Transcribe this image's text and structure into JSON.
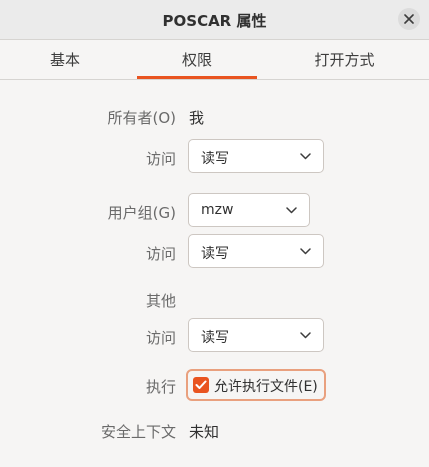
{
  "window": {
    "title": "POSCAR 属性"
  },
  "tabs": [
    {
      "label": "基本"
    },
    {
      "label": "权限"
    },
    {
      "label": "打开方式"
    }
  ],
  "owner": {
    "label": "所有者(O)",
    "value": "我",
    "access_label": "访问",
    "access_value": "读写"
  },
  "group": {
    "label": "用户组(G)",
    "value": "mzw",
    "access_label": "访问",
    "access_value": "读写"
  },
  "others": {
    "label": "其他",
    "access_label": "访问",
    "access_value": "读写"
  },
  "execute": {
    "label": "执行",
    "checkbox_label": "允许执行文件(E)",
    "checked": true
  },
  "security": {
    "label": "安全上下文",
    "value": "未知"
  },
  "colors": {
    "accent": "#e95420"
  },
  "icons": {
    "close": "close-icon",
    "dropdown": "chevron-down-icon",
    "check": "check-icon"
  }
}
